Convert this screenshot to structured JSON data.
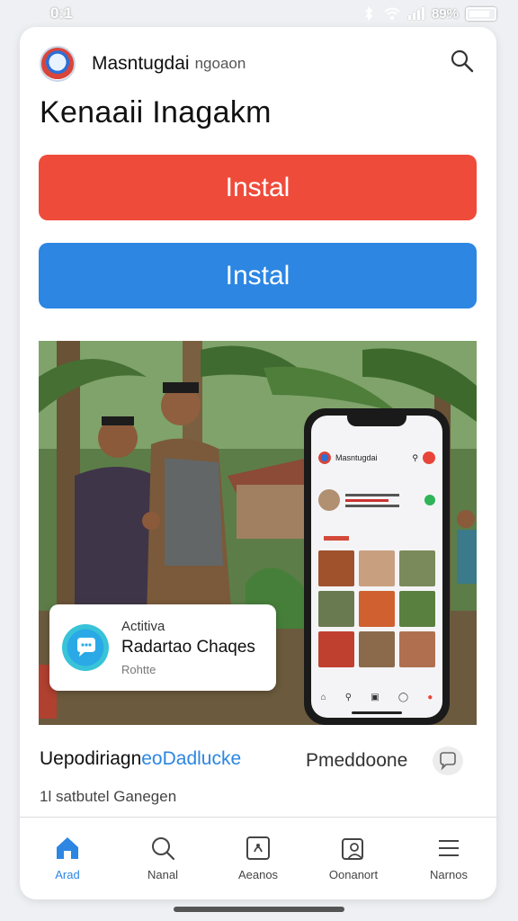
{
  "status_bar": {
    "time": "0:1",
    "battery": "89%"
  },
  "app": {
    "name": "Masntugdai",
    "subtitle": "ngoaon",
    "page_title": "Kenaaii Inagakm"
  },
  "buttons": {
    "install_primary": "Instal",
    "install_secondary": "Instal"
  },
  "notification": {
    "line1": "Actitiva",
    "line2": "Radartao Chaqes",
    "line3": "Rohtte"
  },
  "phone_preview": {
    "app_name": "Masntugdai"
  },
  "section": {
    "title_part1": "Uepodiriagn",
    "title_part2": "eoDadlucke",
    "side_label": "Pmeddoone",
    "subtitle": "1l satbutel Ganegen"
  },
  "nav": {
    "items": [
      {
        "label": "Arad",
        "icon": "home-icon"
      },
      {
        "label": "Nanal",
        "icon": "search-icon"
      },
      {
        "label": "Aeanos",
        "icon": "apps-icon"
      },
      {
        "label": "Oonanort",
        "icon": "contacts-icon"
      },
      {
        "label": "Narnos",
        "icon": "menu-icon"
      }
    ]
  },
  "colors": {
    "install_red": "#ef4b3b",
    "install_blue": "#2c86e2",
    "accent": "#2c86e2"
  }
}
